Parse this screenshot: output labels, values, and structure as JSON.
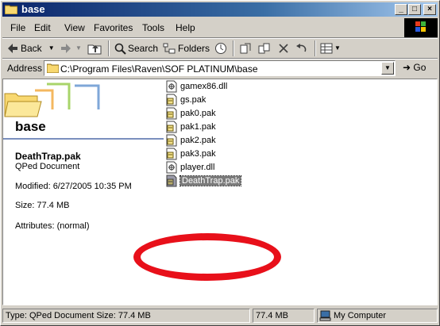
{
  "window": {
    "title": "base"
  },
  "menu": [
    "File",
    "Edit",
    "View",
    "Favorites",
    "Tools",
    "Help"
  ],
  "toolbar": {
    "back": "Back",
    "search": "Search",
    "folders": "Folders"
  },
  "address": {
    "label": "Address",
    "path": "C:\\Program Files\\Raven\\SOF PLATINUM\\base",
    "go": "Go"
  },
  "webview": {
    "folder_name": "base",
    "selected_name": "DeathTrap.pak",
    "selected_type": "QPed Document",
    "modified": "Modified: 6/27/2005 10:35 PM",
    "size": "Size: 77.4 MB",
    "attributes": "Attributes: (normal)"
  },
  "files": [
    {
      "name": "gamex86.dll",
      "icon": "dll-icon"
    },
    {
      "name": "gs.pak",
      "icon": "pak-icon"
    },
    {
      "name": "pak0.pak",
      "icon": "pak-icon"
    },
    {
      "name": "pak1.pak",
      "icon": "pak-icon"
    },
    {
      "name": "pak2.pak",
      "icon": "pak-icon"
    },
    {
      "name": "pak3.pak",
      "icon": "pak-icon"
    },
    {
      "name": "player.dll",
      "icon": "dll-icon"
    },
    {
      "name": "DeathTrap.pak",
      "icon": "pak-icon",
      "selected": true
    }
  ],
  "status": {
    "info": "Type: QPed Document Size: 77.4 MB",
    "size": "77.4 MB",
    "zone": "My Computer"
  },
  "colors": {
    "titlebar": "#0a246a",
    "highlight_circle": "#e8101a",
    "selection": "#7b7b7b"
  }
}
